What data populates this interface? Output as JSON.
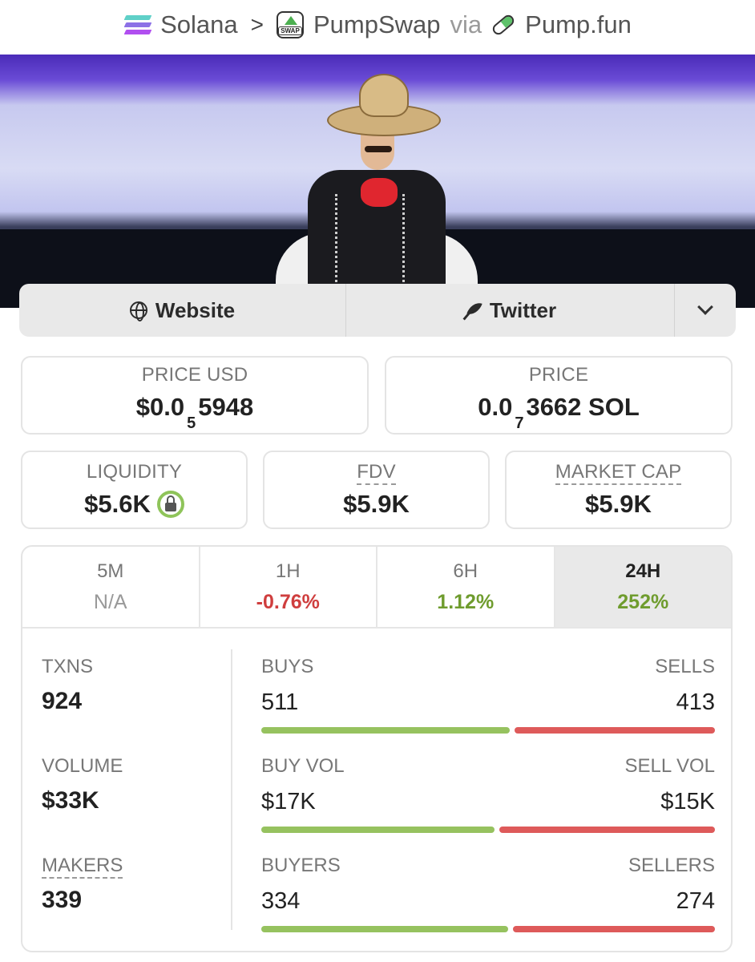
{
  "breadcrumb": {
    "chain": "Solana",
    "separator": ">",
    "dex": "PumpSwap",
    "dex_icon_text": "SWAP",
    "via": "via",
    "launchpad": "Pump.fun"
  },
  "icons": {
    "chain": "solana-icon",
    "dex": "pumpswap-icon",
    "launchpad": "pill-icon",
    "website": "globe-icon",
    "twitter": "feather-icon",
    "more": "chevron-down-icon",
    "liquidity_lock": "lock-icon"
  },
  "links": {
    "website": "Website",
    "twitter": "Twitter"
  },
  "price_usd": {
    "label": "PRICE USD",
    "prefix": "$0.0",
    "zeros": "5",
    "digits": "5948"
  },
  "price_native": {
    "label": "PRICE",
    "prefix": "0.0",
    "zeros": "7",
    "digits": "3662 SOL"
  },
  "liquidity": {
    "label": "LIQUIDITY",
    "value": "$5.6K"
  },
  "fdv": {
    "label": "FDV",
    "value": "$5.9K"
  },
  "market_cap": {
    "label": "MARKET CAP",
    "value": "$5.9K"
  },
  "tabs": [
    {
      "label": "5M",
      "value": "N/A"
    },
    {
      "label": "1H",
      "value": "-0.76%"
    },
    {
      "label": "6H",
      "value": "1.12%"
    },
    {
      "label": "24H",
      "value": "252%"
    }
  ],
  "stats": {
    "txns": {
      "label": "TXNS",
      "value": "924"
    },
    "volume": {
      "label": "VOLUME",
      "value": "$33K"
    },
    "makers": {
      "label": "MAKERS",
      "value": "339"
    },
    "buys_sells": {
      "left_label": "BUYS",
      "right_label": "SELLS",
      "left": "511",
      "right": "413",
      "buy_fraction": 0.553
    },
    "vol_split": {
      "left_label": "BUY VOL",
      "right_label": "SELL VOL",
      "left": "$17K",
      "right": "$15K",
      "buy_fraction": 0.52
    },
    "buyers_sellers": {
      "left_label": "BUYERS",
      "right_label": "SELLERS",
      "left": "334",
      "right": "274",
      "buy_fraction": 0.55
    }
  },
  "colors": {
    "positive": "#6f9c2e",
    "negative": "#cf3e3e",
    "buy_bar": "#96c25f",
    "sell_bar": "#de5a5a"
  }
}
